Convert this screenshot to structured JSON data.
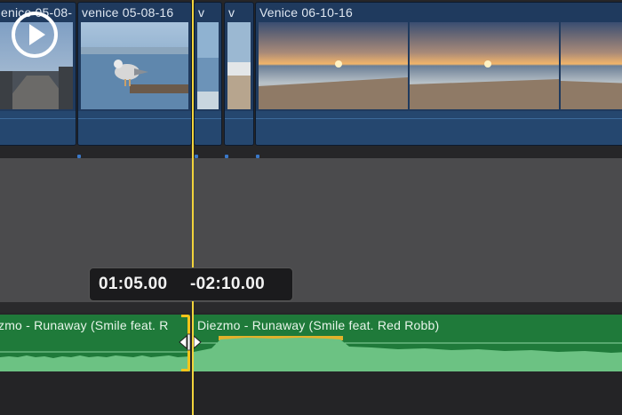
{
  "video_clips": [
    {
      "title": "enice 05-08-"
    },
    {
      "title": "venice 05-08-16"
    },
    {
      "title": "v"
    },
    {
      "title": "v"
    },
    {
      "title": "Venice 06-10-16"
    }
  ],
  "audio_clips": [
    {
      "title": "zmo - Runaway (Smile feat. R"
    },
    {
      "title": "Diezmo - Runaway (Smile feat. Red Robb)"
    }
  ],
  "tooltip": {
    "start": "01:05.00",
    "end": "-02:10.00"
  },
  "colors": {
    "playhead": "#f2d43b",
    "video_clip": "#1f3a5e",
    "audio_clip": "#1f7a3a",
    "waveform": "#6cc283",
    "trim_handle": "#f2c41a"
  },
  "icons": {
    "play": "play-circle-icon",
    "trim_cursor": "ripple-trim-cursor-icon"
  }
}
